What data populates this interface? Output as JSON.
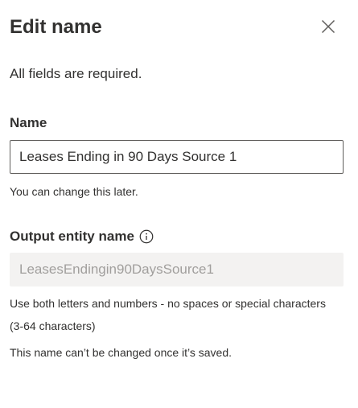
{
  "panel": {
    "title": "Edit name",
    "close_icon": "close-icon",
    "required_note": "All fields are required."
  },
  "name_field": {
    "label": "Name",
    "value": "Leases Ending in 90 Days Source 1",
    "helper": "You can change this later."
  },
  "output_entity_field": {
    "label": "Output entity name",
    "info_icon": "info-icon",
    "value": "LeasesEndingin90DaysSource1",
    "disabled": true,
    "helper_rules": "Use both letters and numbers - no spaces or special characters (3-64 characters)",
    "helper_locked": "This name can’t be changed once it’s saved."
  },
  "colors": {
    "text": "#323130",
    "disabled_bg": "#f3f2f1",
    "disabled_text": "#a19f9d",
    "input_border": "#605e5c"
  }
}
